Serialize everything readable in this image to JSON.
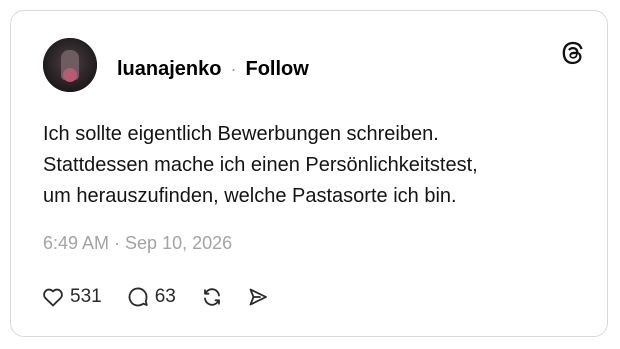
{
  "post": {
    "username": "luanajenko",
    "separator": "·",
    "follow_label": "Follow",
    "text_lines": [
      "Ich sollte eigentlich Bewerbungen schreiben.",
      "Stattdessen mache ich einen Persönlichkeitstest,",
      "um herauszufinden, welche Pastasorte ich bin."
    ],
    "timestamp": "6:49 AM · Sep 10, 2026",
    "likes": "531",
    "replies": "63"
  },
  "icons": {
    "logo": "threads-logo-icon",
    "like": "heart-icon",
    "reply": "comment-bubble-icon",
    "repost": "repost-arrows-icon",
    "share": "send-icon"
  }
}
